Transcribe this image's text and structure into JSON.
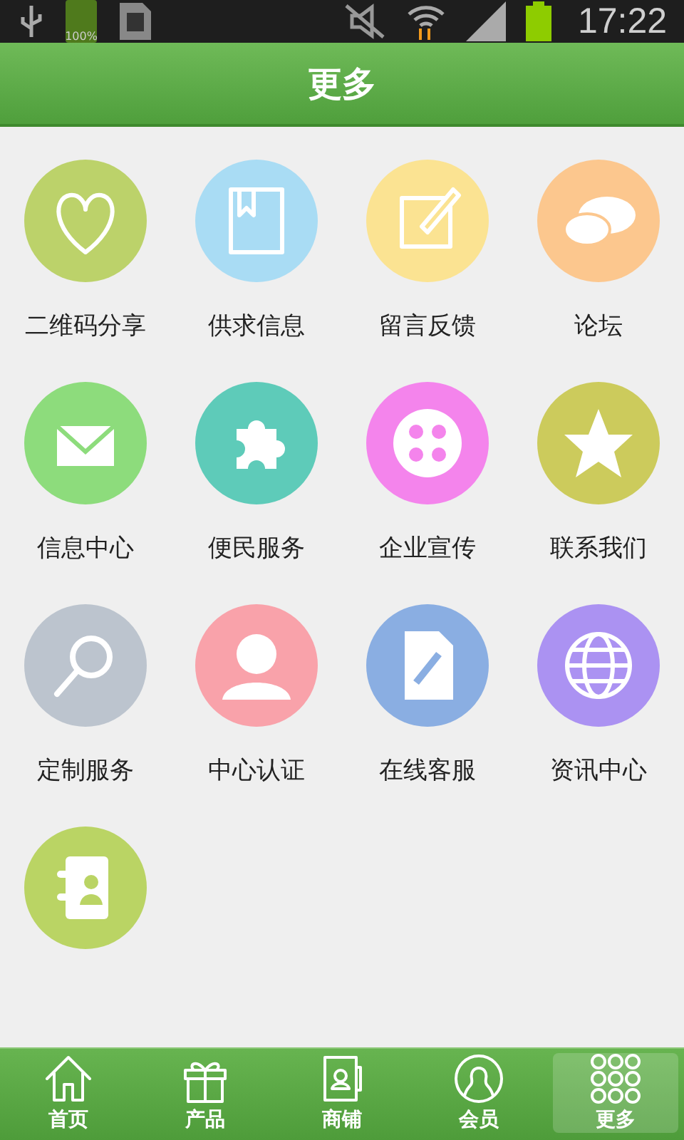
{
  "status_bar": {
    "battery_label": "100%",
    "time": "17:22"
  },
  "header": {
    "title": "更多"
  },
  "items": [
    {
      "kind": "heart",
      "color": "#bcd26a",
      "label": "二维码分享"
    },
    {
      "kind": "book",
      "color": "#a9dcf4",
      "label": "供求信息"
    },
    {
      "kind": "note",
      "color": "#fbe392",
      "label": "留言反馈"
    },
    {
      "kind": "chat",
      "color": "#fcc78e",
      "label": "论坛"
    },
    {
      "kind": "mail",
      "color": "#8ddc7c",
      "label": "信息中心"
    },
    {
      "kind": "puzzle",
      "color": "#5ecbb9",
      "label": "便民服务"
    },
    {
      "kind": "film",
      "color": "#f484ec",
      "label": "企业宣传"
    },
    {
      "kind": "star",
      "color": "#cccb5c",
      "label": "联系我们"
    },
    {
      "kind": "search",
      "color": "#bcc4ce",
      "label": "定制服务"
    },
    {
      "kind": "person",
      "color": "#f9a2aa",
      "label": "中心认证"
    },
    {
      "kind": "doc",
      "color": "#8aaee2",
      "label": "在线客服"
    },
    {
      "kind": "globe",
      "color": "#ab92f2",
      "label": "资讯中心"
    },
    {
      "kind": "contacts",
      "color": "#bad464"
    }
  ],
  "tabs": [
    {
      "kind": "home",
      "label": "首页",
      "selected": false
    },
    {
      "kind": "gift",
      "label": "产品",
      "selected": false
    },
    {
      "kind": "shop",
      "label": "商铺",
      "selected": false
    },
    {
      "kind": "member",
      "label": "会员",
      "selected": false
    },
    {
      "kind": "more",
      "label": "更多",
      "selected": true
    }
  ]
}
